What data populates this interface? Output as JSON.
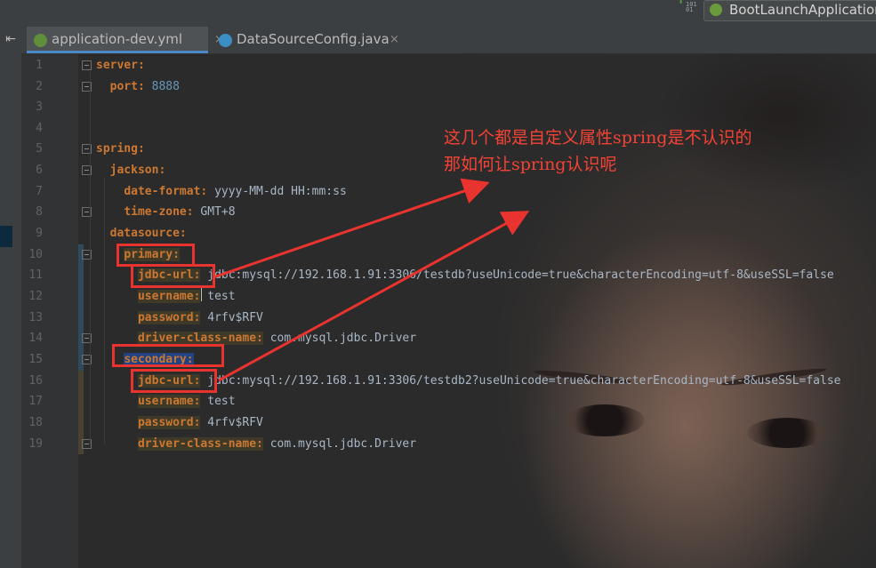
{
  "toolbar": {
    "build_icon": "build-icon",
    "build_bits": "101\n01",
    "run_config_label": "BootLaunchApplication",
    "run_config_icon": "spring-boot-icon"
  },
  "tabs": [
    {
      "label": "application-dev.yml",
      "icon": "spring-yml-icon",
      "close": "×",
      "active": true
    },
    {
      "label": "DataSourceConfig.java",
      "icon": "java-class-icon",
      "close": "×",
      "active": false
    }
  ],
  "side_collapse": "⇤",
  "editor": {
    "line_numbers": [
      "1",
      "2",
      "3",
      "4",
      "5",
      "6",
      "7",
      "8",
      "9",
      "10",
      "11",
      "12",
      "13",
      "14",
      "15",
      "16",
      "17",
      "18",
      "19"
    ],
    "lines": {
      "l1_key": "server:",
      "l2_key": "port:",
      "l2_val": "8888",
      "l5_key": "spring:",
      "l6_key": "jackson:",
      "l7_key": "date-format:",
      "l7_val": "yyyy-MM-dd HH:mm:ss",
      "l8_key": "time-zone:",
      "l8_val": "GMT+8",
      "l9_key": "datasource:",
      "l10_key": "primary:",
      "l11_key": "jdbc-url:",
      "l11_val": "jdbc:mysql://192.168.1.91:3306/testdb?useUnicode=true&characterEncoding=utf-8&useSSL=false",
      "l12_key": "username:",
      "l12_val": "test",
      "l13_key": "password:",
      "l13_val": "4rfv$RFV",
      "l14_key": "driver-class-name:",
      "l14_val": "com.mysql.jdbc.Driver",
      "l15_key": "secondary:",
      "l16_key": "jdbc-url:",
      "l16_val": "jdbc:mysql://192.168.1.91:3306/testdb2?useUnicode=true&characterEncoding=utf-8&useSSL=false",
      "l17_key": "username:",
      "l17_val": "test",
      "l18_key": "password:",
      "l18_val": "4rfv$RFV",
      "l19_key": "driver-class-name:",
      "l19_val": "com.mysql.jdbc.Driver"
    }
  },
  "annotation": {
    "line1": "这几个都是自定义属性spring是不认识的",
    "line2": "那如何让spring认识呢",
    "color": "#e8332e"
  }
}
